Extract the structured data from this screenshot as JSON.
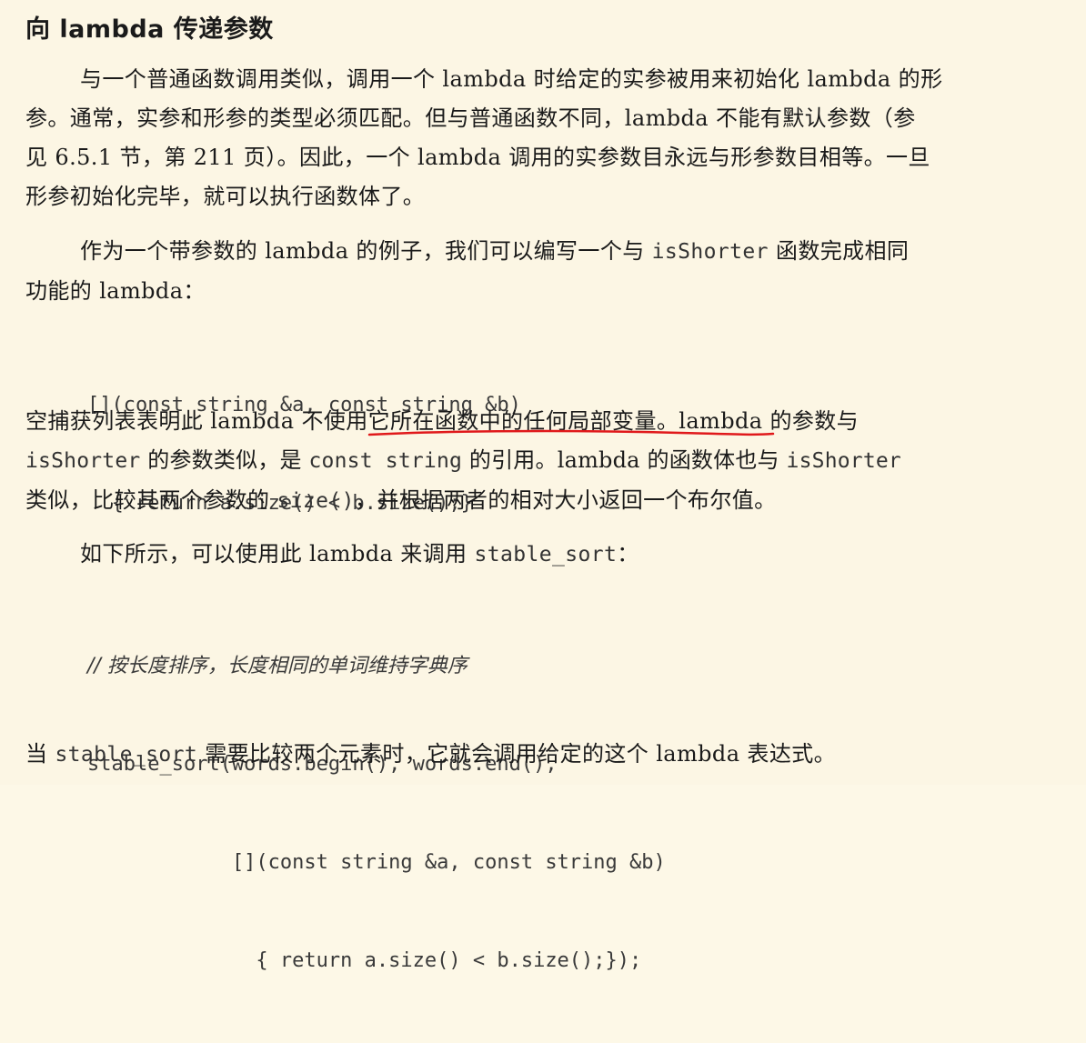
{
  "heading": "向 lambda 传递参数",
  "p1": {
    "line1": "与一个普通函数调用类似，调用一个 lambda 时给定的实参被用来初始化 lambda 的形",
    "line2": "参。通常，实参和形参的类型必须匹配。但与普通函数不同，lambda 不能有默认参数（参",
    "line3": "见 6.5.1 节，第 211 页）。因此，一个 lambda 调用的实参数目永远与形参数目相等。一旦",
    "line4": "形参初始化完毕，就可以执行函数体了。"
  },
  "p2": {
    "line1_pre": "作为一个带参数的 lambda 的例子，我们可以编写一个与 ",
    "line1_code": "isShorter",
    "line1_post": " 函数完成相同",
    "line2": "功能的 lambda："
  },
  "code1": {
    "line1": "[](const string &a, const string &b)",
    "line2": "  { return a.size() < b.size();}"
  },
  "p3": {
    "line1_pre": "空捕获列表表明此 lambda ",
    "line1_mid": "不使用它所在函数中的任何局部",
    "line1_post": "变量。lambda 的参数与",
    "line2_code1": "isShorter",
    "line2_mid1": " 的参数类似，是 ",
    "line2_code2": "const string",
    "line2_mid2": " 的引用。lambda 的函数体也与 ",
    "line2_code3": "isShorter",
    "line3_pre": "类似，比较其两个参数的 ",
    "line3_code": "size()",
    "line3_post": "，并根据两者的相对大小返回一个布尔值。"
  },
  "p4": {
    "text": "如下所示，可以使用此 lambda 来调用 ",
    "code": "stable_sort",
    "post": "："
  },
  "code2": {
    "comment": "// 按长度排序，长度相同的单词维持字典序",
    "line1": "stable_sort(words.begin(), words.end(),",
    "line2": "            [](const string &a, const string &b)",
    "line3": "              { return a.size() < b.size();});"
  },
  "p5": {
    "pre": "当 ",
    "code": "stable_sort",
    "post": " 需要比较两个元素时，它就会调用给定的这个 lambda 表达式。"
  },
  "colors": {
    "background": "#fcf6e4",
    "text": "#1a1a1a",
    "underline": "#e0191b"
  }
}
